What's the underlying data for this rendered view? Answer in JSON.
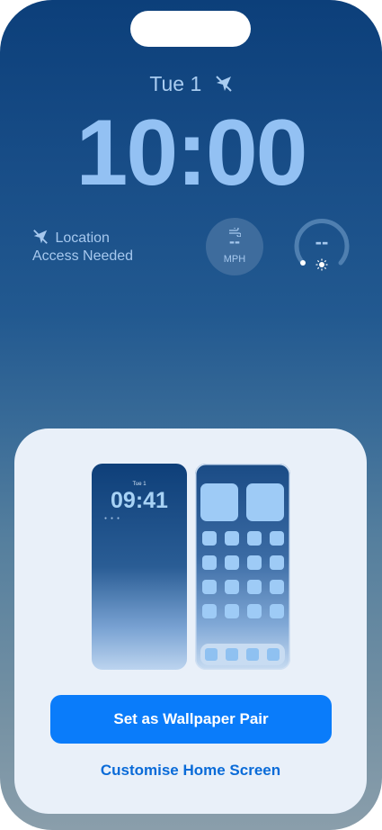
{
  "lock": {
    "date": "Tue 1",
    "time": "10:00"
  },
  "widgets": {
    "location_line1": "Location",
    "location_line2": "Access Needed",
    "wind_value": "--",
    "wind_unit": "MPH",
    "uv_value": "--"
  },
  "preview": {
    "lock_date": "Tue 1",
    "lock_time": "09:41"
  },
  "actions": {
    "primary": "Set as Wallpaper Pair",
    "secondary": "Customise Home Screen"
  },
  "colors": {
    "accent": "#0a7cfa",
    "link": "#0a6bd8",
    "clock": "#93c1f3"
  }
}
